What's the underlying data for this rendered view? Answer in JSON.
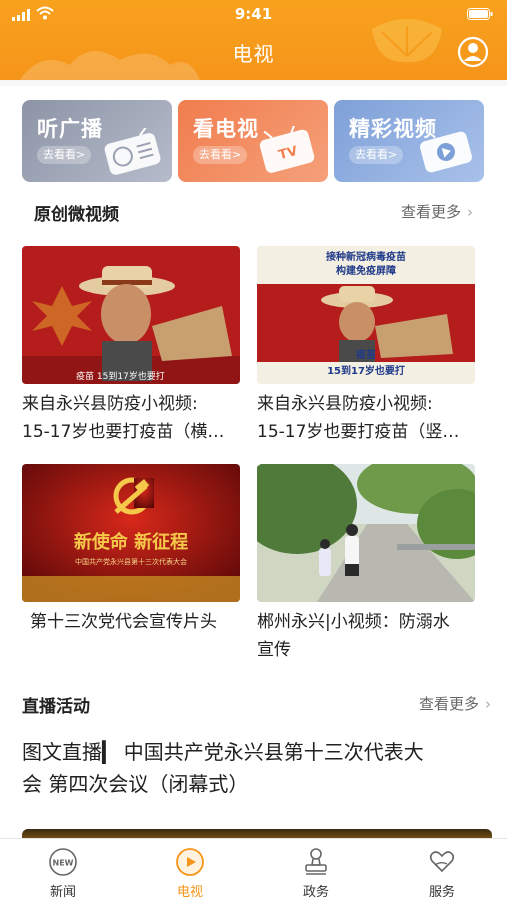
{
  "status": {
    "time": "9:41"
  },
  "header": {
    "title": "电视"
  },
  "categories": [
    {
      "title": "听广播",
      "go": "去看看>"
    },
    {
      "title": "看电视",
      "go": "去看看>"
    },
    {
      "title": "精彩视频",
      "go": "去看看>"
    }
  ],
  "section_videos": {
    "title": "原创微视频",
    "more": "查看更多"
  },
  "videos": [
    {
      "title_line1": "来自永兴县防疫小视频:",
      "title_line2": "15-17岁也要打疫苗（横…",
      "caption": "疫苗 15到17岁也要打"
    },
    {
      "title_line1": "来自永兴县防疫小视频:",
      "title_line2": "15-17岁也要打疫苗（竖…",
      "top_text_1": "接种新冠病毒疫苗",
      "top_text_2": "构建免疫屏障",
      "bottom_text_1": "疫苗",
      "bottom_text_2": "15到17岁也要打"
    },
    {
      "title_line1": "第十三次党代会宣传片头",
      "title_line2": "",
      "slogan": "新使命 新征程",
      "subtitle": "中国共产党永兴县第十三次代表大会"
    },
    {
      "title_line1": "郴州永兴|小视频：防溺水",
      "title_line2": "宣传"
    }
  ],
  "section_live": {
    "title": "直播活动",
    "more": "查看更多"
  },
  "live": {
    "title_line1": "图文直播▎ 中国共产党永兴县第十三次代表大",
    "title_line2": "会 第四次会议（闭幕式）"
  },
  "tabs": [
    {
      "label": "新闻",
      "icon": "news-icon"
    },
    {
      "label": "电视",
      "icon": "tv-play-icon"
    },
    {
      "label": "政务",
      "icon": "stamp-icon"
    },
    {
      "label": "服务",
      "icon": "heart-hand-icon"
    }
  ],
  "colors": {
    "accent": "#f5951a",
    "header": "#f8a21e"
  }
}
